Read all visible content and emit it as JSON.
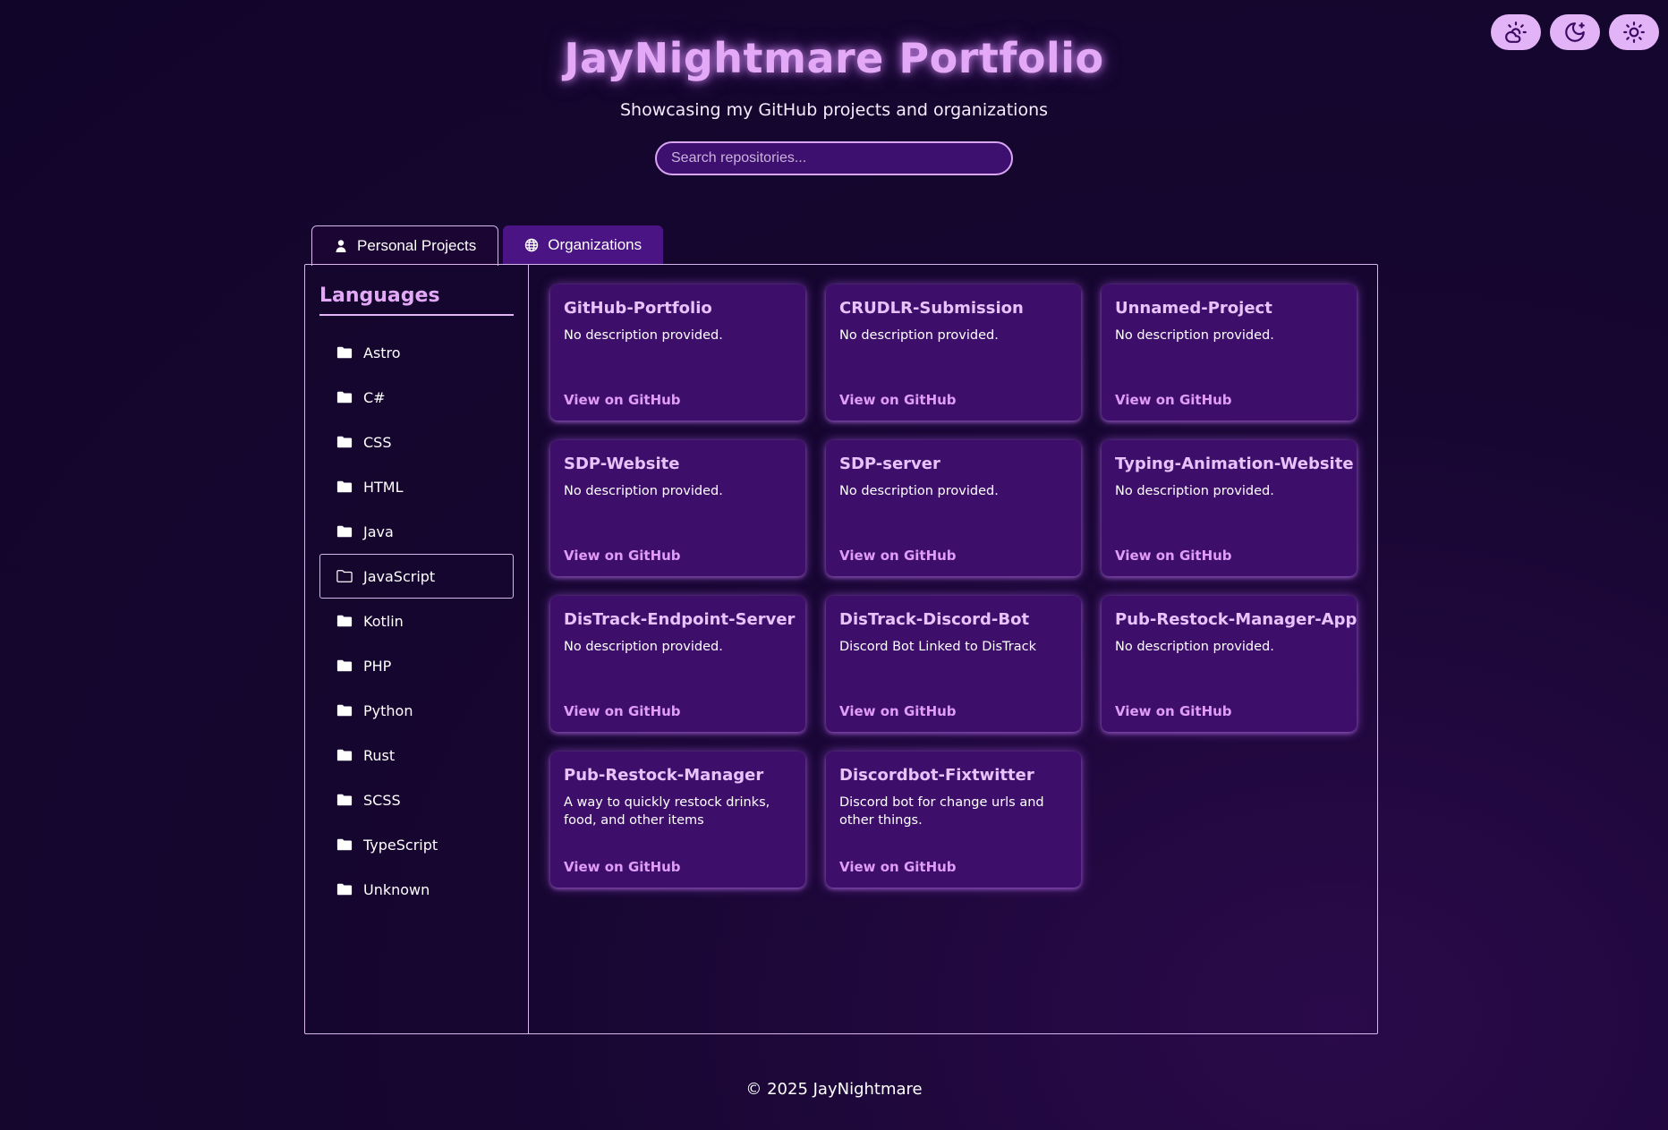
{
  "header": {
    "title": "JayNightmare Portfolio",
    "subtitle": "Showcasing my GitHub projects and organizations"
  },
  "search": {
    "placeholder": "Search repositories...",
    "value": ""
  },
  "theme_buttons": [
    {
      "icon": "cloud-sun-icon"
    },
    {
      "icon": "moon-stars-icon"
    },
    {
      "icon": "sun-icon"
    }
  ],
  "tabs": [
    {
      "label": "Personal Projects",
      "icon": "user-icon",
      "active": true
    },
    {
      "label": "Organizations",
      "icon": "globe-icon",
      "active": false
    }
  ],
  "sidebar": {
    "title": "Languages",
    "items": [
      {
        "label": "Astro"
      },
      {
        "label": "C#"
      },
      {
        "label": "CSS"
      },
      {
        "label": "HTML"
      },
      {
        "label": "Java"
      },
      {
        "label": "JavaScript",
        "active": true
      },
      {
        "label": "Kotlin"
      },
      {
        "label": "PHP"
      },
      {
        "label": "Python"
      },
      {
        "label": "Rust"
      },
      {
        "label": "SCSS"
      },
      {
        "label": "TypeScript"
      },
      {
        "label": "Unknown"
      }
    ]
  },
  "repos": [
    {
      "name": "GitHub-Portfolio",
      "description": "No description provided.",
      "link": "View on GitHub"
    },
    {
      "name": "CRUDLR-Submission",
      "description": "No description provided.",
      "link": "View on GitHub"
    },
    {
      "name": "Unnamed-Project",
      "description": "No description provided.",
      "link": "View on GitHub"
    },
    {
      "name": "SDP-Website",
      "description": "No description provided.",
      "link": "View on GitHub"
    },
    {
      "name": "SDP-server",
      "description": "No description provided.",
      "link": "View on GitHub"
    },
    {
      "name": "Typing-Animation-Website",
      "description": "No description provided.",
      "link": "View on GitHub"
    },
    {
      "name": "DisTrack-Endpoint-Server",
      "description": "No description provided.",
      "link": "View on GitHub"
    },
    {
      "name": "DisTrack-Discord-Bot",
      "description": "Discord Bot Linked to DisTrack",
      "link": "View on GitHub"
    },
    {
      "name": "Pub-Restock-Manager-App",
      "description": "No description provided.",
      "link": "View on GitHub"
    },
    {
      "name": "Pub-Restock-Manager",
      "description": "A way to quickly restock drinks, food, and other items",
      "link": "View on GitHub"
    },
    {
      "name": "Discordbot-Fixtwitter",
      "description": "Discord bot for change urls and other things.",
      "link": "View on GitHub"
    }
  ],
  "footer": {
    "text": "© 2025 JayNightmare"
  },
  "colors": {
    "accent": "#e3a9f7",
    "card_bg": "#3d0f6b",
    "page_bg": "#160630",
    "link": "#e09cf7"
  }
}
